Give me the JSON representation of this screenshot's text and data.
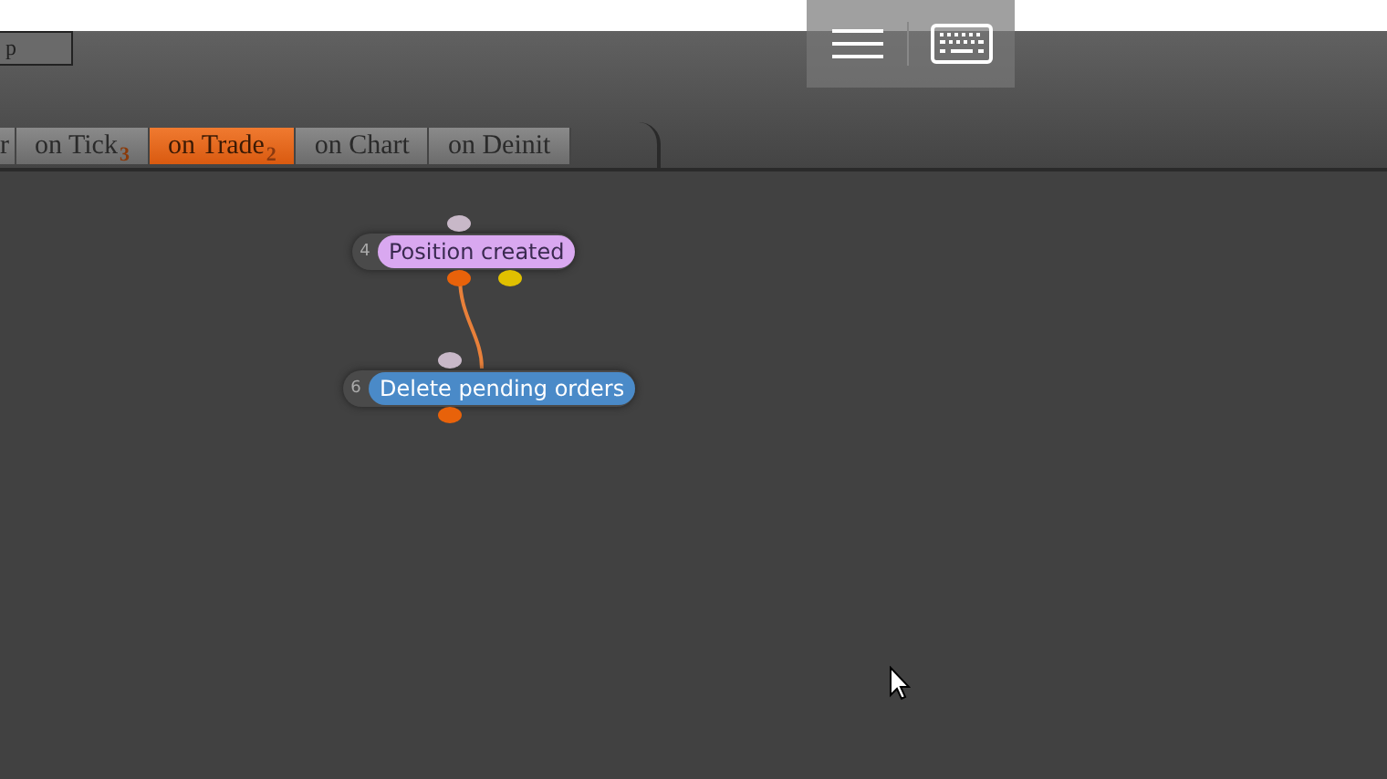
{
  "toolbar_button": {
    "label": "p"
  },
  "tabs": [
    {
      "label": "r",
      "selected": false
    },
    {
      "label": "on Tick",
      "count": "3",
      "selected": false
    },
    {
      "label": "on Trade",
      "count": "2",
      "selected": true
    },
    {
      "label": "on Chart",
      "selected": false
    },
    {
      "label": "on Deinit",
      "selected": false
    }
  ],
  "nodes": [
    {
      "number": "4",
      "label": "Position created",
      "color": "#d9a8f0",
      "outputs": [
        {
          "color": "#e8620a"
        },
        {
          "color": "#e0c000"
        }
      ]
    },
    {
      "number": "6",
      "label": "Delete pending orders",
      "color": "#4a8ac8",
      "outputs": [
        {
          "color": "#e8620a"
        }
      ]
    }
  ]
}
